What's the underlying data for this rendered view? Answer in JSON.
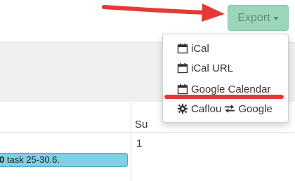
{
  "export_button": {
    "label": "Export"
  },
  "dropdown": {
    "items": [
      {
        "label": "iCal",
        "icon": "calendar-icon"
      },
      {
        "label": "iCal URL",
        "icon": "calendar-icon"
      },
      {
        "label": "Google Calendar",
        "icon": "calendar-icon"
      },
      {
        "label_left": "Caflou",
        "label_right": "Google",
        "icon": "gear-icon",
        "sync_icon": "sync-arrows-icon"
      }
    ]
  },
  "calendar": {
    "day_name": "Su",
    "day_number": "1",
    "event": {
      "bold_prefix": "0",
      "text": " task 25-30.6."
    }
  },
  "colors": {
    "accent_button": "#9bd5ba",
    "annotation_red": "#e53935",
    "event_bar": "#7fd0e4"
  }
}
